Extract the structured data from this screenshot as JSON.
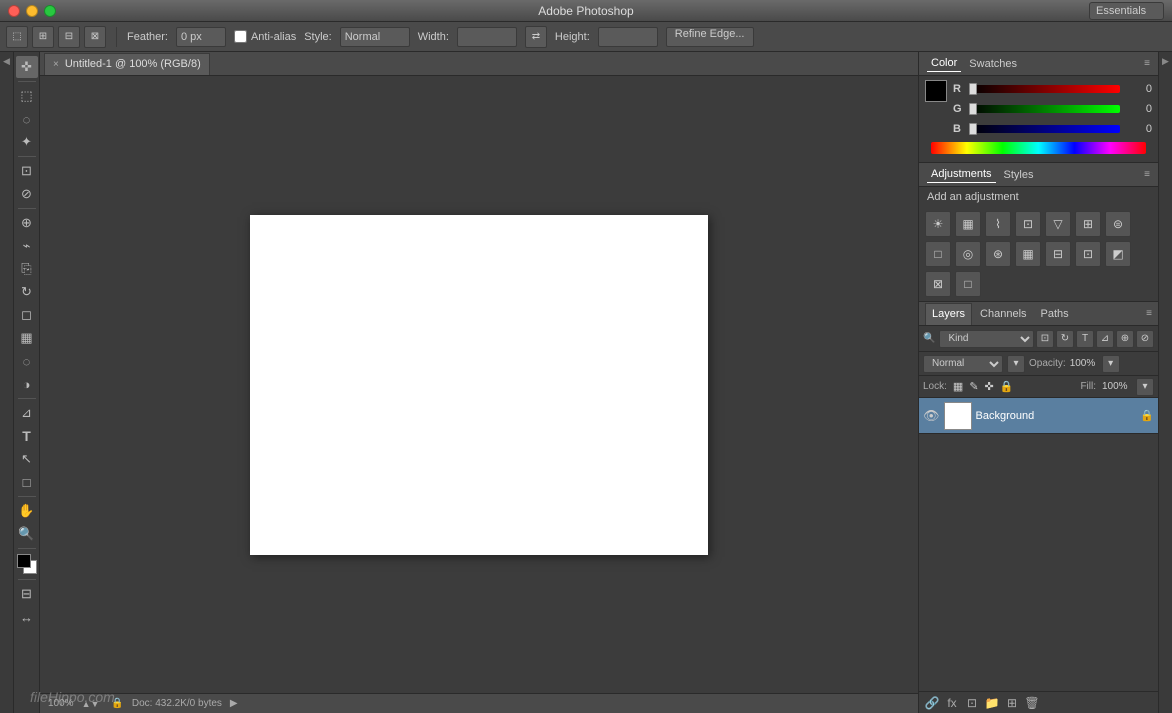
{
  "titlebar": {
    "title": "Adobe Photoshop",
    "workspace": "Essentials"
  },
  "options_bar": {
    "feather_label": "Feather:",
    "feather_value": "0 px",
    "antialias_label": "Anti-alias",
    "style_label": "Style:",
    "style_value": "Normal",
    "width_label": "Width:",
    "height_label": "Height:",
    "refine_edge_label": "Refine Edge..."
  },
  "tab": {
    "close_icon": "×",
    "title": "Untitled-1 @ 100% (RGB/8)"
  },
  "status_bar": {
    "zoom": "100%",
    "doc_info": "Doc: 432.2K/0 bytes"
  },
  "color_panel": {
    "tab1": "Color",
    "tab2": "Swatches",
    "r_label": "R",
    "r_value": "0",
    "g_label": "G",
    "g_value": "0",
    "b_label": "B",
    "b_value": "0"
  },
  "adjustments_panel": {
    "tab1": "Adjustments",
    "tab2": "Styles",
    "title": "Add an adjustment"
  },
  "layers_panel": {
    "tab1": "Layers",
    "tab2": "Channels",
    "tab3": "Paths",
    "kind_label": "Kind",
    "blend_mode": "Normal",
    "opacity_label": "Opacity:",
    "opacity_value": "100%",
    "fill_label": "Fill:",
    "fill_value": "100%",
    "lock_label": "Lock:",
    "layer_name": "Background"
  },
  "tools": [
    {
      "name": "move-tool",
      "icon": "✜",
      "title": "Move"
    },
    {
      "name": "marquee-tool",
      "icon": "⬚",
      "title": "Rectangular Marquee"
    },
    {
      "name": "lasso-tool",
      "icon": "⌀",
      "title": "Lasso"
    },
    {
      "name": "magic-wand-tool",
      "icon": "✦",
      "title": "Magic Wand"
    },
    {
      "name": "crop-tool",
      "icon": "⊡",
      "title": "Crop"
    },
    {
      "name": "eyedropper-tool",
      "icon": "⊘",
      "title": "Eyedropper"
    },
    {
      "name": "healing-tool",
      "icon": "⊕",
      "title": "Healing"
    },
    {
      "name": "brush-tool",
      "icon": "⌁",
      "title": "Brush"
    },
    {
      "name": "clone-tool",
      "icon": "⎘",
      "title": "Clone"
    },
    {
      "name": "history-brush-tool",
      "icon": "↻",
      "title": "History Brush"
    },
    {
      "name": "eraser-tool",
      "icon": "◻",
      "title": "Eraser"
    },
    {
      "name": "gradient-tool",
      "icon": "▦",
      "title": "Gradient"
    },
    {
      "name": "blur-tool",
      "icon": "◌",
      "title": "Blur"
    },
    {
      "name": "dodge-tool",
      "icon": "◑",
      "title": "Dodge"
    },
    {
      "name": "pen-tool",
      "icon": "⊿",
      "title": "Pen"
    },
    {
      "name": "type-tool",
      "icon": "T",
      "title": "Type"
    },
    {
      "name": "path-selection-tool",
      "icon": "↖",
      "title": "Path Selection"
    },
    {
      "name": "shape-tool",
      "icon": "□",
      "title": "Shape"
    },
    {
      "name": "hand-tool",
      "icon": "✋",
      "title": "Hand"
    },
    {
      "name": "zoom-tool",
      "icon": "⊕",
      "title": "Zoom"
    },
    {
      "name": "extra-tool",
      "icon": "↔",
      "title": "Extra"
    }
  ],
  "watermark": "fileHippo.com"
}
